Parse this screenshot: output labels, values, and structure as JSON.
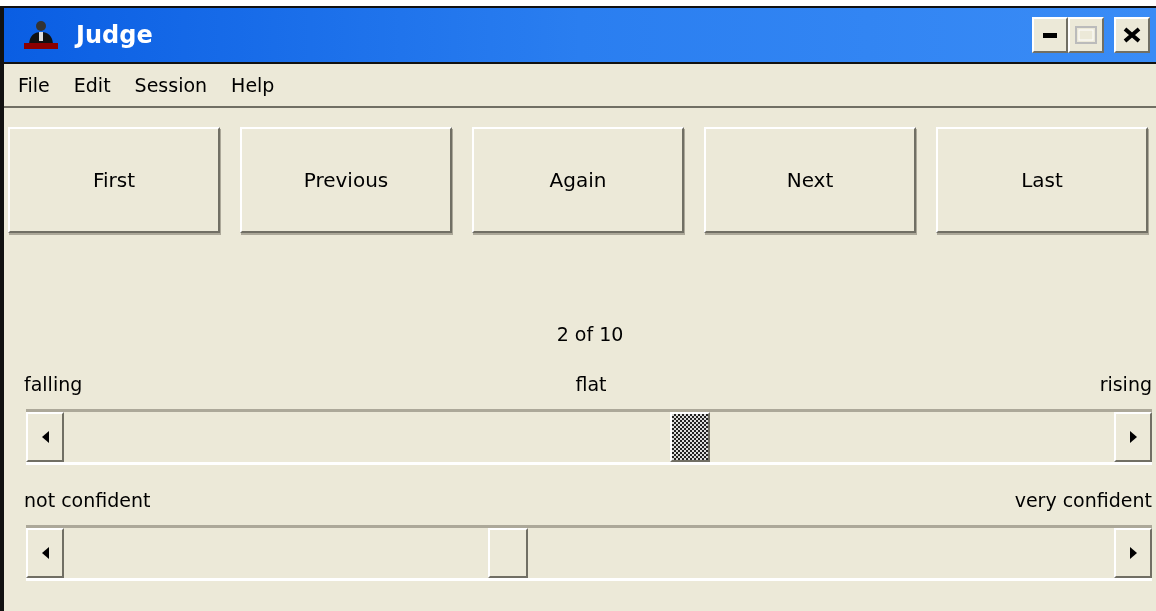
{
  "window": {
    "title": "Judge"
  },
  "menu": [
    "File",
    "Edit",
    "Session",
    "Help"
  ],
  "buttons": [
    "First",
    "Previous",
    "Again",
    "Next",
    "Last"
  ],
  "counter": "2 of 10",
  "sliders": [
    {
      "labels": [
        "falling",
        "flat",
        "rising"
      ],
      "focused": true
    },
    {
      "labels": [
        "not confident",
        "very confident"
      ],
      "focused": false
    }
  ]
}
